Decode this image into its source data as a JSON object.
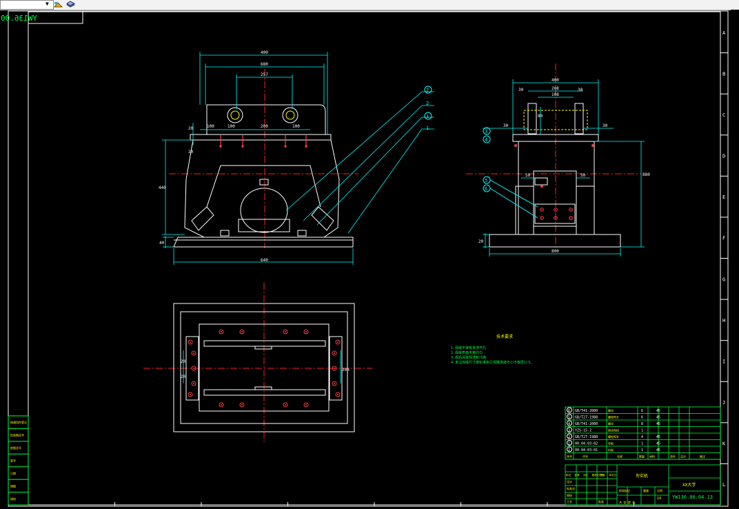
{
  "drawing_title_mirrored": "YW136.00.04.13",
  "colors": {
    "background": "#000000",
    "border": "#ffffff",
    "frame": "#00ff40",
    "dimension": "#00ffff",
    "centerline": "#ff2020",
    "bolt": "#ff4040",
    "hidden": "#ffff00",
    "text_yellow": "#ffff00"
  },
  "zones_right": [
    "A",
    "B",
    "C",
    "D",
    "E",
    "F",
    "G",
    "H",
    "I",
    "J",
    "K",
    "L"
  ],
  "front_view": {
    "dims": {
      "top_width": "400",
      "mid_width": "680",
      "hole_span": "257",
      "spacing1": "100",
      "spacing2": "100",
      "spacing3": "200",
      "spacing4": "100",
      "height": "440",
      "left_20a": "20",
      "left_20b": "20",
      "base_40": "40",
      "base_width": "640"
    }
  },
  "side_view": {
    "dims": {
      "top": "400",
      "d30a": "30",
      "d208": "208",
      "d108": "108",
      "d30b": "30",
      "d30c": "30",
      "d80": "80",
      "d50a": "50",
      "d50b": "50",
      "height": "880",
      "base": "800",
      "base_h": "20"
    }
  },
  "plan_view": {
    "dims": {
      "d20a": "20",
      "d20b": "20",
      "d300": "300"
    }
  },
  "balloons": [
    "2",
    "2",
    "1",
    "1",
    "3",
    "4",
    "5",
    "6"
  ],
  "tech_title": "技术要求",
  "tech_notes": [
    "1.焊缝不得有夹渣气孔",
    "2.焊缝表面平整均匀",
    "3.焊后清除焊渣和飞溅",
    "4.未注焊缝尺寸按标准执行焊脚高度不小于板厚1/3。"
  ],
  "left_stamps": [
    "借通用件登记",
    "旧底图总号",
    "底图总号",
    "签字",
    "日期",
    "描图",
    "描校"
  ],
  "bom": [
    {
      "no": "6",
      "code": "GB/T41-2000",
      "name": "螺母",
      "qty": "6",
      "mat": "45"
    },
    {
      "no": "5",
      "code": "GB/T27-1988",
      "name": "螺栓M18",
      "qty": "6",
      "mat": "45"
    },
    {
      "no": "4",
      "code": "GB/T41-2000",
      "name": "螺母",
      "qty": "8",
      "mat": "45"
    },
    {
      "no": "3",
      "code": "YZS-15-2",
      "name": "振动电机",
      "qty": "1",
      "mat": ""
    },
    {
      "no": "2",
      "code": "GB/T27-1988",
      "name": "螺栓M20",
      "qty": "4",
      "mat": "45"
    },
    {
      "no": "1",
      "code": "00.04.03-02",
      "name": "夯板",
      "qty": "1",
      "mat": "45"
    },
    {
      "no": "1",
      "code": "00.04.03-01",
      "name": "机架",
      "qty": "1",
      "mat": "45"
    }
  ],
  "bom_header": {
    "no": "序号",
    "code": "代号",
    "name": "名称",
    "qty": "数量",
    "mat": "材料",
    "mass1": "单件",
    "mass2": "总计",
    "remark": "备注"
  },
  "title_block": {
    "part_name": "夯实机",
    "company": "XX大学",
    "drawing_no": "YW136.00.04.13",
    "stage_label": "阶段标记",
    "weight_label": "重量",
    "scale_label": "比例",
    "sheet": "共 张 第 张",
    "designer": "设计",
    "standardization": "标准化",
    "check": "审核",
    "process": "工艺",
    "approve": "批准",
    "count": "14",
    "labels": [
      "标记",
      "处数",
      "分区",
      "更改文件号",
      "签名",
      "年月日"
    ]
  }
}
